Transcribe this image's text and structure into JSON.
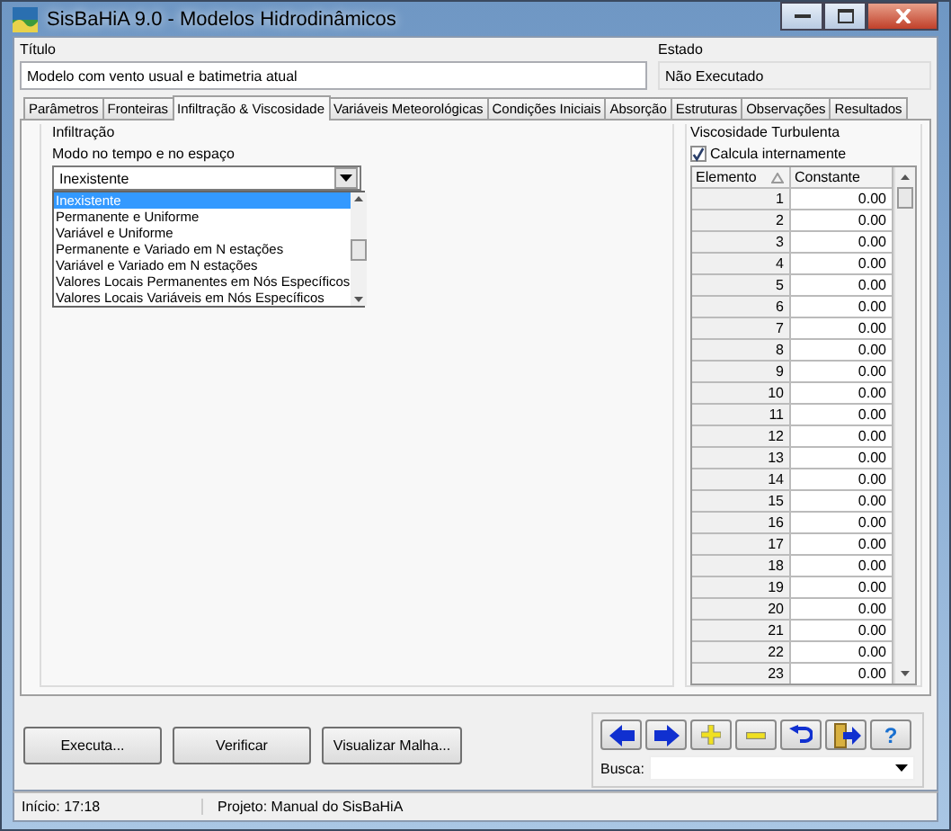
{
  "window": {
    "title": "SisBaHiA 9.0 - Modelos Hidrodinâmicos"
  },
  "header": {
    "title_label": "Título",
    "title_value": "Modelo com vento usual e batimetria atual",
    "state_label": "Estado",
    "state_value": "Não Executado"
  },
  "tabs": [
    {
      "label": "Parâmetros",
      "selected": false
    },
    {
      "label": "Fronteiras",
      "selected": false
    },
    {
      "label": "Infiltração & Viscosidade",
      "selected": true
    },
    {
      "label": "Variáveis Meteorológicas",
      "selected": false
    },
    {
      "label": "Condições Iniciais",
      "selected": false
    },
    {
      "label": "Absorção",
      "selected": false
    },
    {
      "label": "Estruturas",
      "selected": false
    },
    {
      "label": "Observações",
      "selected": false
    },
    {
      "label": "Resultados",
      "selected": false
    }
  ],
  "infiltration": {
    "group_label": "Infiltração",
    "mode_label": "Modo no tempo e no espaço",
    "combo_value": "Inexistente",
    "options": [
      {
        "label": "Inexistente",
        "selected": true
      },
      {
        "label": "Permanente e Uniforme",
        "selected": false
      },
      {
        "label": "Variável e Uniforme",
        "selected": false
      },
      {
        "label": "Permanente e Variado em N estações",
        "selected": false
      },
      {
        "label": "Variável e Variado em N estações",
        "selected": false
      },
      {
        "label": "Valores Locais Permanentes em Nós Específicos",
        "selected": false
      },
      {
        "label": "Valores Locais Variáveis em Nós Específicos",
        "selected": false
      }
    ]
  },
  "viscosity": {
    "group_label": "Viscosidade Turbulenta",
    "checkbox": {
      "label": "Calcula internamente",
      "checked": true
    },
    "columns": [
      "Elemento",
      "Constante"
    ],
    "rows": [
      [
        "1",
        "0.00"
      ],
      [
        "2",
        "0.00"
      ],
      [
        "3",
        "0.00"
      ],
      [
        "4",
        "0.00"
      ],
      [
        "5",
        "0.00"
      ],
      [
        "6",
        "0.00"
      ],
      [
        "7",
        "0.00"
      ],
      [
        "8",
        "0.00"
      ],
      [
        "9",
        "0.00"
      ],
      [
        "10",
        "0.00"
      ],
      [
        "11",
        "0.00"
      ],
      [
        "12",
        "0.00"
      ],
      [
        "13",
        "0.00"
      ],
      [
        "14",
        "0.00"
      ],
      [
        "15",
        "0.00"
      ],
      [
        "16",
        "0.00"
      ],
      [
        "17",
        "0.00"
      ],
      [
        "18",
        "0.00"
      ],
      [
        "19",
        "0.00"
      ],
      [
        "20",
        "0.00"
      ],
      [
        "21",
        "0.00"
      ],
      [
        "22",
        "0.00"
      ],
      [
        "23",
        "0.00"
      ]
    ]
  },
  "buttons": [
    "Executa...",
    "Verificar",
    "Visualizar Malha..."
  ],
  "toolbar": {
    "tools": [
      {
        "kind": "left"
      },
      {
        "kind": "right"
      },
      {
        "kind": "plus"
      },
      {
        "kind": "minus"
      },
      {
        "kind": "undo"
      },
      {
        "kind": "exit"
      },
      {
        "kind": "help",
        "label": "?"
      }
    ],
    "search_label": "Busca:"
  },
  "status_bar": [
    "Início: 17:18",
    "Projeto: Manual do SisBaHiA"
  ]
}
